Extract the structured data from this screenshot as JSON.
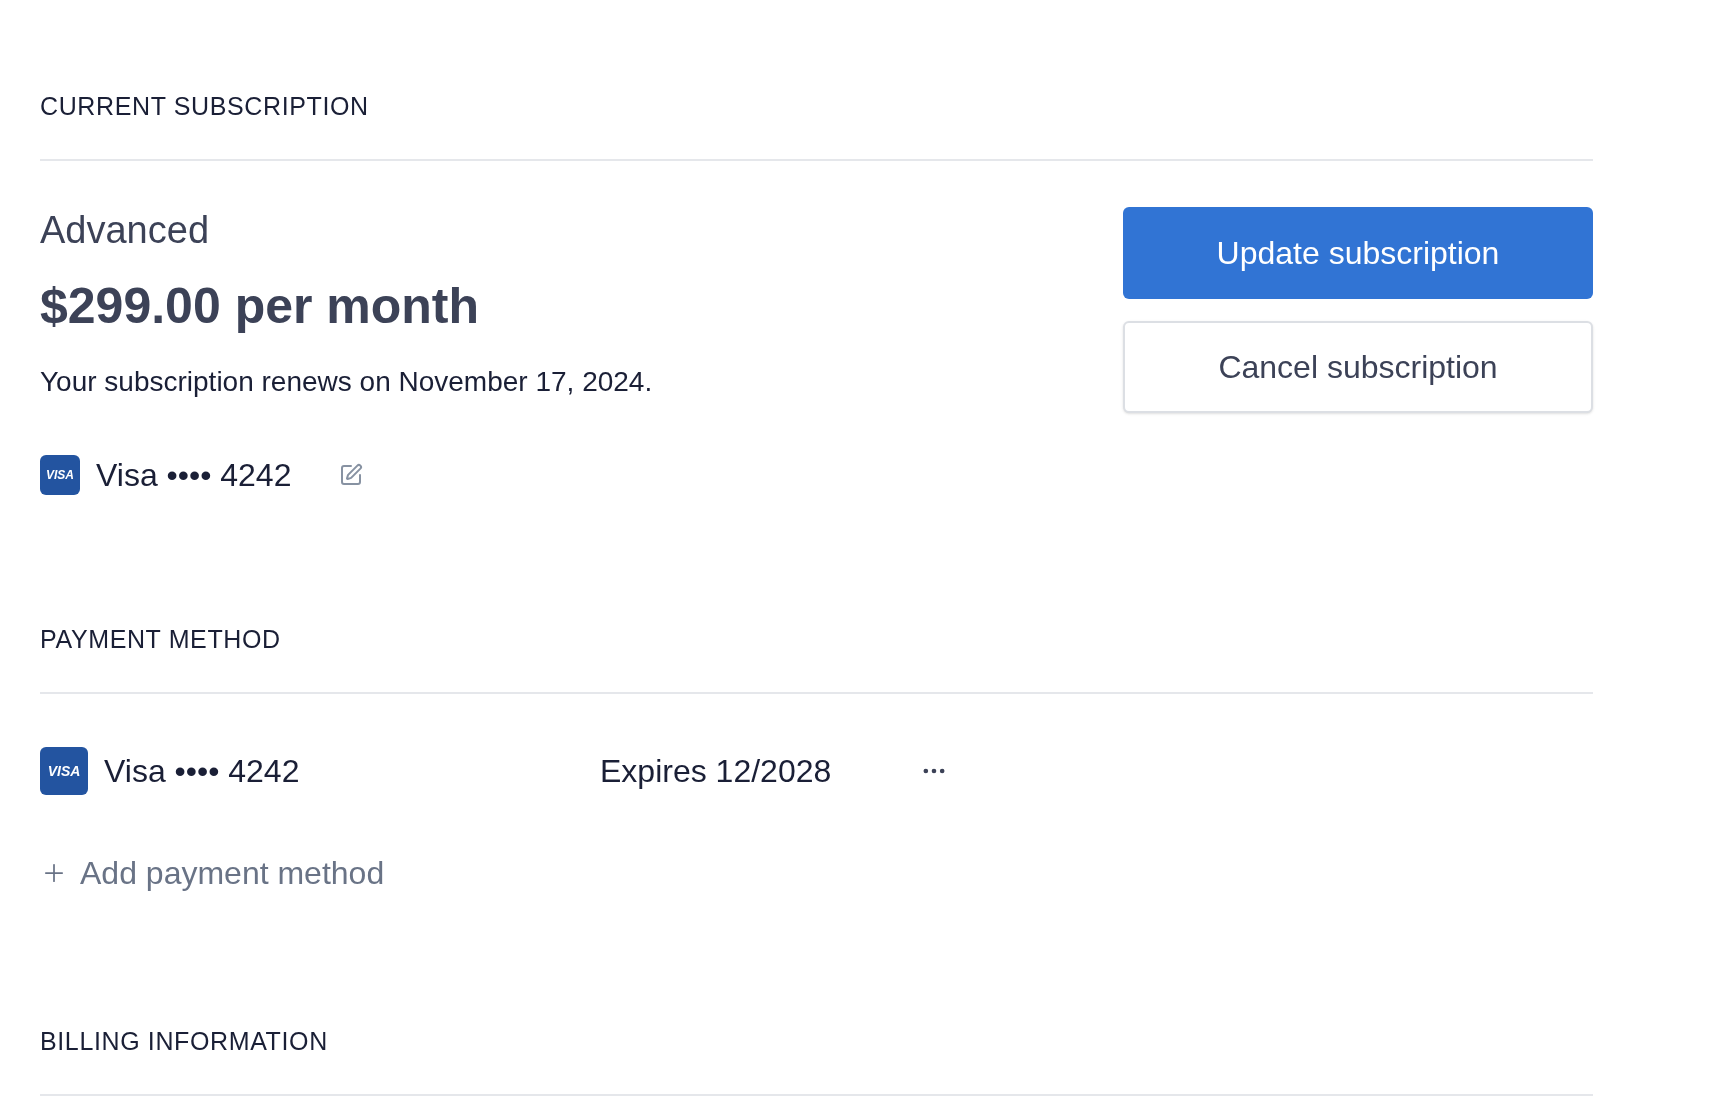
{
  "current_subscription": {
    "heading": "CURRENT SUBSCRIPTION",
    "plan": "Advanced",
    "price": "$299.00 per month",
    "renewal_note": "Your subscription renews on November 17, 2024.",
    "card": {
      "brand_mark": "VISA",
      "label": "Visa •••• 4242"
    },
    "buttons": [
      {
        "label": "Update subscription",
        "kind": "primary"
      },
      {
        "label": "Cancel subscription",
        "kind": "secondary"
      }
    ]
  },
  "payment_method": {
    "heading": "PAYMENT METHOD",
    "methods": [
      {
        "brand_mark": "VISA",
        "label": "Visa •••• 4242",
        "expiry": "Expires 12/2028"
      }
    ],
    "add_label": "Add payment method"
  },
  "billing_information": {
    "heading": "BILLING INFORMATION"
  }
}
